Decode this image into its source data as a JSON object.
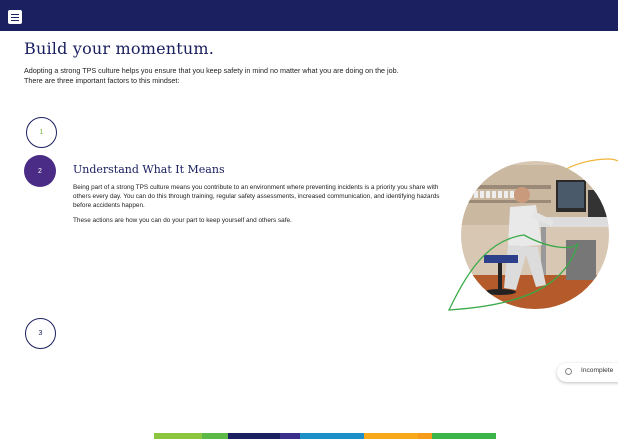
{
  "header": {
    "menu_icon": "hamburger-menu-icon"
  },
  "page": {
    "title": "Build your momentum.",
    "intro_line1": "Adopting a strong TPS culture helps you ensure that you keep safety in mind no matter what you are doing on the job.",
    "intro_line2": "There are three important factors to this mindset:"
  },
  "steps": [
    {
      "number": "1"
    },
    {
      "number": "2"
    },
    {
      "number": "3"
    }
  ],
  "factor": {
    "title": "Understand What It Means",
    "paragraph1": "Being part of a strong TPS culture means you contribute to an environment where preventing incidents is a priority you share with others every day. You can do this through training, regular safety assessments, increased communication, and identifying hazards before accidents happen.",
    "paragraph2": "These actions are how you can do your part to keep yourself and others safe."
  },
  "status": {
    "label": "Incomplete"
  },
  "colors": {
    "header": "#1b2060",
    "active_step": "#4a2c86",
    "accent_green": "#7bbf3f",
    "footer_segments": [
      "#8cc63f",
      "#5cb947",
      "#1b2060",
      "#3a2f8a",
      "#1e90c9",
      "#f7a81b",
      "#f59a1b",
      "#3bb54a"
    ]
  }
}
